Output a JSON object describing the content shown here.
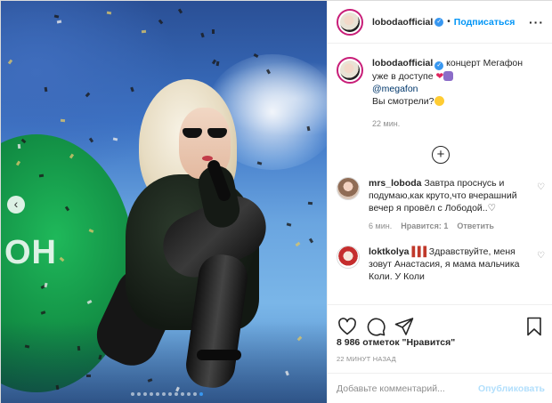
{
  "header": {
    "username": "lobodaofficial",
    "separator": "•",
    "follow_label": "Подписаться",
    "more_label": "···"
  },
  "caption": {
    "username": "lobodaofficial",
    "text": "концерт Мегафон уже в доступе",
    "mention": "@megafon",
    "question": "Вы смотрели?",
    "time": "22 мин."
  },
  "comments": [
    {
      "username": "mrs_loboda",
      "text": "Завтра проснусь и подумаю,как круто,что вчерашний вечер я провёл с Лободой..",
      "time": "6 мин.",
      "likes": "Нравится: 1",
      "reply": "Ответить"
    },
    {
      "username": "loktkolya",
      "marks": "▌▌▌",
      "text": "Здравствуйте, меня зовут Анастасия, я мама мальчика Коли. У Коли"
    }
  ],
  "photo": {
    "banner_text": "ОН",
    "prev_label": "‹",
    "slide_count": 12,
    "active_slide": 11
  },
  "likes": "8 986 отметок \"Нравится\"",
  "timestamp": "22 МИНУТ НАЗАД",
  "comment_input": {
    "placeholder": "Добавьте комментарий...",
    "publish_label": "Опубликовать"
  },
  "icons": {
    "verified": "verified-badge-icon",
    "plus": "plus-circle-icon",
    "like": "heart-icon",
    "comment": "comment-icon",
    "share": "share-icon",
    "save": "bookmark-icon"
  },
  "colors": {
    "accent": "#0095f6",
    "link": "#00376b",
    "muted": "#8e8e8e",
    "publish_disabled": "#b2dffc"
  }
}
